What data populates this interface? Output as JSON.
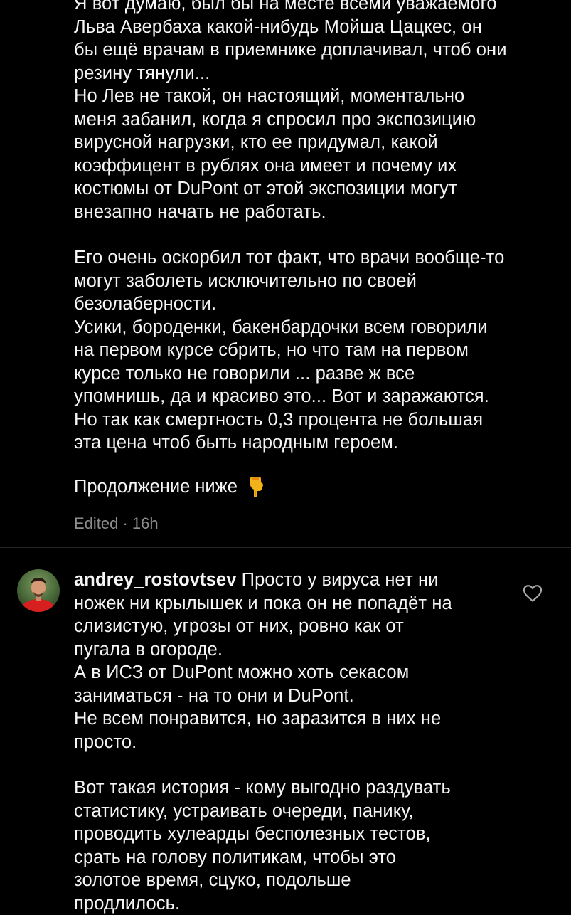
{
  "comment_top": {
    "lines": [
      "Я вот думаю, был бы на месте всеми уважаемого",
      "Льва Авербаха какой-нибудь Мойша Цацкес, он",
      "бы ещё врачам в приемнике доплачивал, чтоб они",
      "резину тянули...",
      "Но Лев не такой, он настоящий, моментально",
      "меня забанил, когда я спросил про экспозицию",
      "вирусной нагрузки, кто ее придумал, какой",
      "коэффицент в рублях она имеет и почему их",
      "костюмы от DuPont от этой экспозиции могут",
      "внезапно начать не работать.",
      "Его очень оскорбил тот факт, что врачи вообще-то",
      "могут заболеть исключительно по своей",
      "безолаберности.",
      "Усики, бороденки, бакенбардочки всем говорили",
      "на первом курсе сбрить, но что там на первом",
      "курсе только не говорили ... разве ж все",
      "упомнишь, да и красиво это... Вот и заражаются.",
      "Но так как смертность 0,3 процента не большая",
      "эта цена чтоб быть народным героем."
    ],
    "continue_text": "Продолжение ниже",
    "pointer_icon": "backhand-index-pointing-down-emoji",
    "meta": "Edited · 16h"
  },
  "comment_bottom": {
    "username": "andrey_rostovtsev",
    "first_line": "Просто у вируса нет ни",
    "lines": [
      "ножек ни крылышек и пока он не попадёт на",
      "слизистую, угрозы от них, ровно как от",
      "пугала в огороде.",
      "А в ИСЗ от DuPont можно хоть секасом",
      "заниматься - на то они и DuPont.",
      "Не всем понравится, но заразится в них не",
      "просто.",
      "Вот такая история - кому выгодно раздувать",
      "статистику, устраивать очереди, панику,",
      "проводить хулеарды бесполезных тестов,",
      "срать на голову политикам, чтобы это",
      "золотое время, сцуко, подольше",
      "продлилось."
    ],
    "like_icon": "heart-outline-icon"
  },
  "colors": {
    "background": "#000000",
    "text": "#f5f5f5",
    "meta": "#8e8e8e",
    "divider": "#262626"
  }
}
